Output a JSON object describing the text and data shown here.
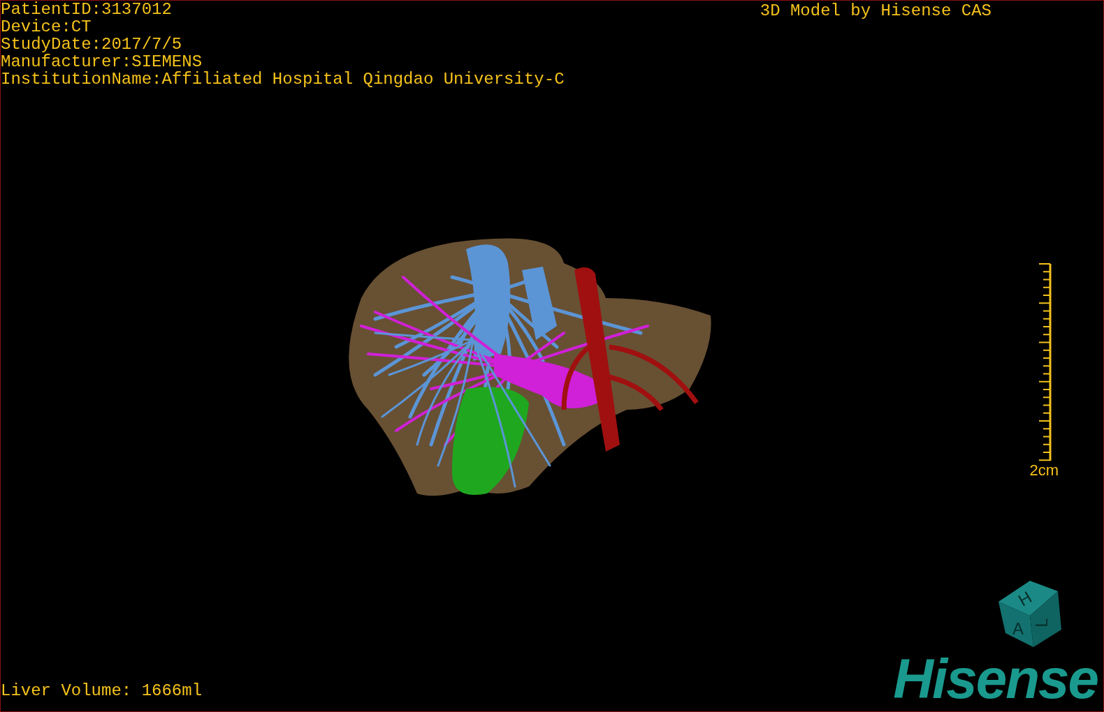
{
  "header": {
    "info_lines": [
      "PatientID:3137012",
      "Device:CT",
      "StudyDate:2017/7/5",
      "Manufacturer:SIEMENS",
      "InstitutionName:Affiliated Hospital Qingdao University-C"
    ],
    "title": "3D Model by Hisense CAS"
  },
  "scale_bar": {
    "label": "2cm"
  },
  "orientation_cube": {
    "labels": [
      "H",
      "A",
      "L"
    ]
  },
  "footer": {
    "liver_volume": "Liver Volume: 1666ml",
    "logo": "Hisense"
  }
}
